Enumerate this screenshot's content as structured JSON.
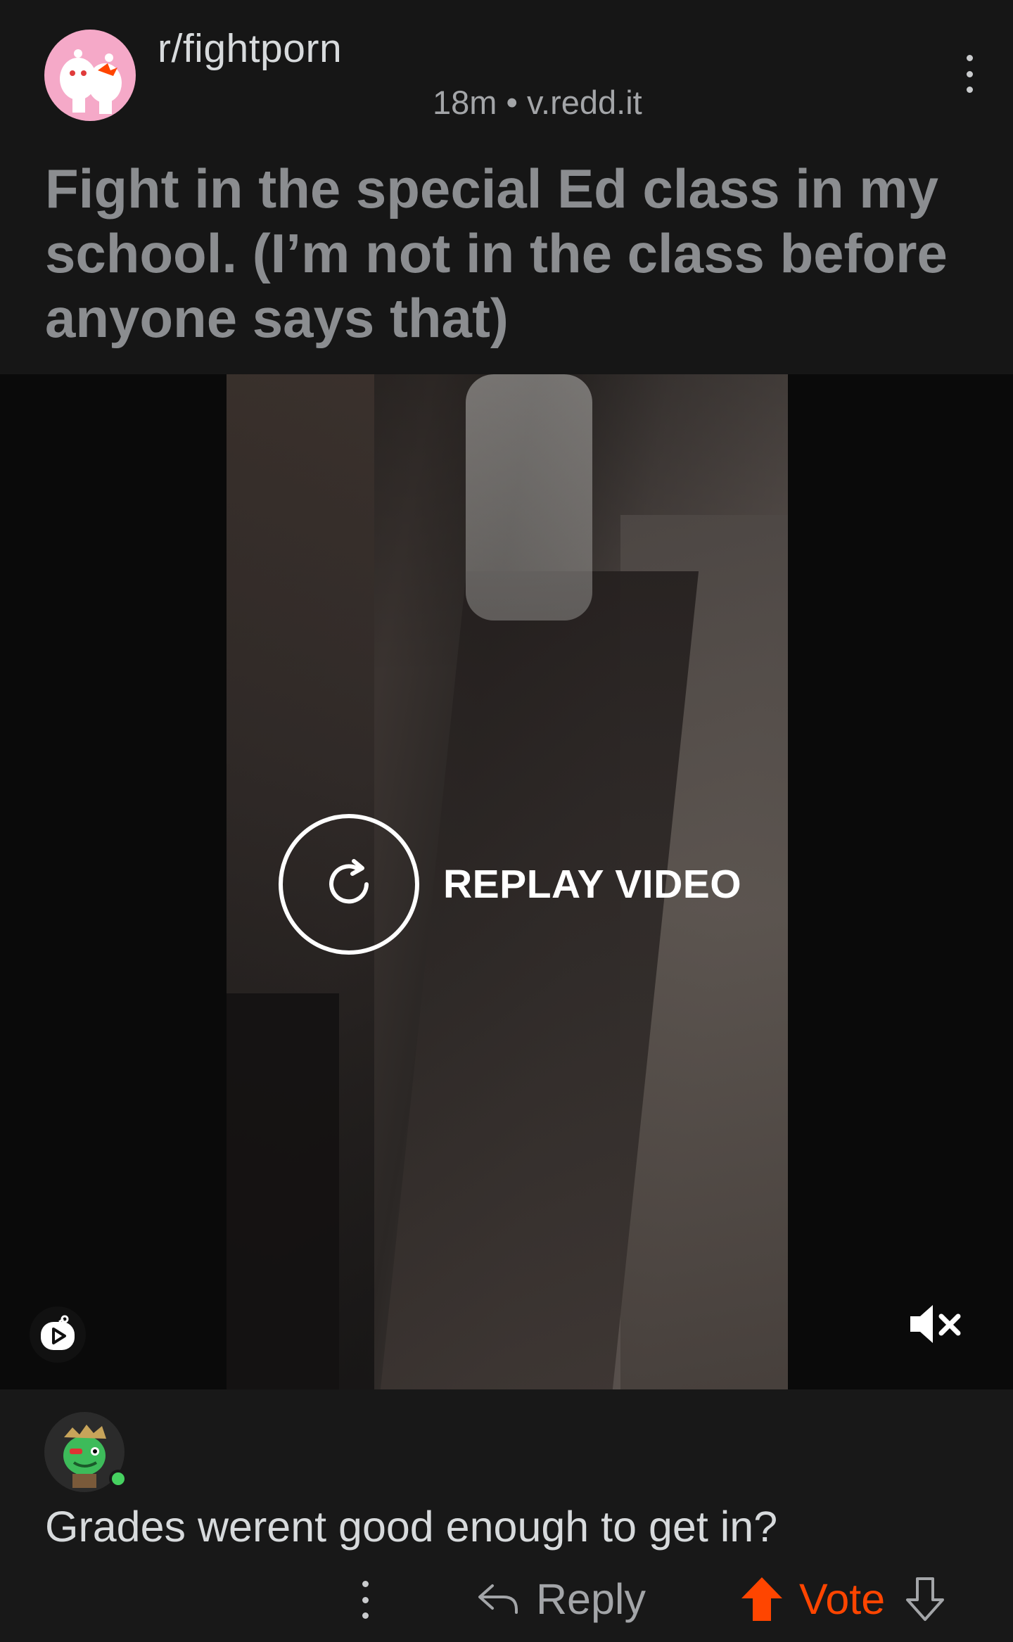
{
  "post": {
    "subreddit": "r/fightporn",
    "meta": "18m • v.redd.it",
    "title": "Fight in the special Ed class in my school. (I’m not in the class before anyone says that)"
  },
  "video": {
    "replay_label": "REPLAY VIDEO",
    "icons": {
      "replay": "replay-icon",
      "rpan": "reddit-video-icon",
      "mute": "muted-speaker-icon"
    }
  },
  "comment": {
    "text": "Grades werent good enough to get in?",
    "reply_label": "Reply",
    "vote_label": "Vote",
    "online_status_color": "#46d160"
  },
  "colors": {
    "accent": "#ff4500",
    "background": "#121212",
    "title_text": "#8b8d90"
  }
}
